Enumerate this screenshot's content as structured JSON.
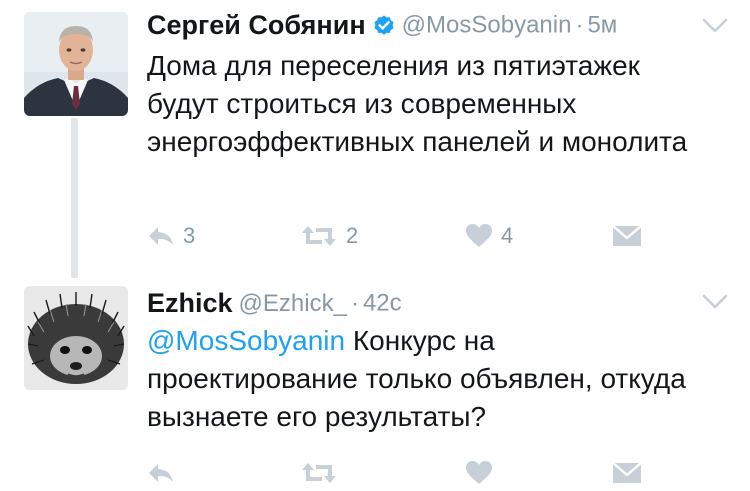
{
  "tweets": [
    {
      "author": "Сергей Собянин",
      "verified": true,
      "handle": "@MosSobyanin",
      "separator": "·",
      "time": "5м",
      "text": "Дома для переселения из пятиэтажек будут строиться из современных энергоэффективных панелей и монолита",
      "reply_count": "3",
      "retweet_count": "2",
      "like_count": "4"
    },
    {
      "author": "Ezhick",
      "handle": "@Ezhick_",
      "separator": "·",
      "time": "42с",
      "mention": "@MosSobyanin",
      "text": " Конкурс на проектирование только объявлен, откуда вызнаете его результаты?"
    }
  ],
  "icons": {
    "reply": "reply-icon",
    "retweet": "retweet-icon",
    "like": "heart-icon",
    "dm": "envelope-icon",
    "more": "chevron-down-icon",
    "verified": "verified-badge-icon"
  },
  "colors": {
    "icon_gray": "#c7d0d8",
    "meta_gray": "#8899a6",
    "link_blue": "#1da1f2",
    "verified_blue": "#1da1f2",
    "thread_line": "#dfe5ea"
  }
}
